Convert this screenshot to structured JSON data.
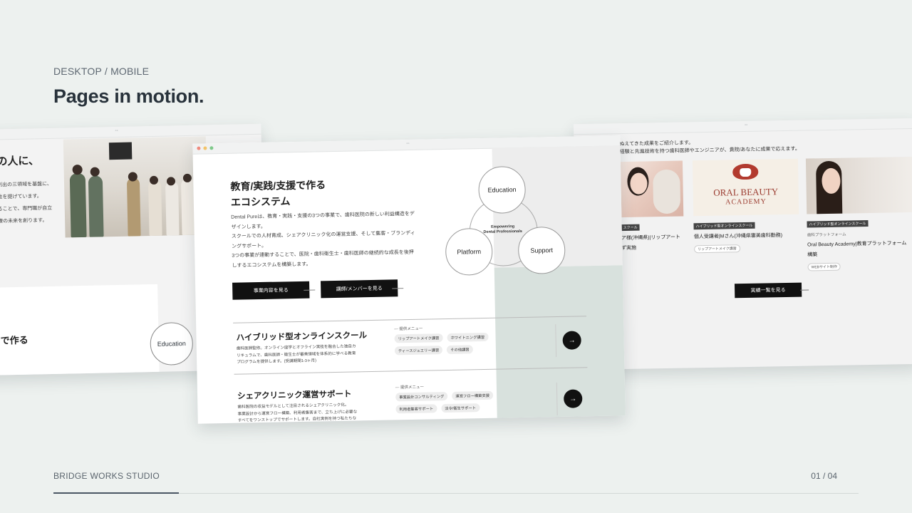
{
  "header": {
    "eyebrow": "DESKTOP / MOBILE",
    "title": "Pages in motion."
  },
  "footer": {
    "brand": "BRIDGE WORKS STUDIO",
    "page": "01 / 04",
    "progress": 0.156
  },
  "left_window": {
    "title": "の人に、",
    "lines": [
      "創出の三領域を基盤に、",
      "性を提げています。",
      "ることで、専門職が自立",
      "療の未来を創ります。"
    ],
    "card_title": "で作る",
    "circle_label": "Education"
  },
  "center_window": {
    "title_1": "教育/実践/支援で作る",
    "title_2": "エコシステム",
    "lead": [
      "Dental Pureは、教育・実践・支援の3つの事業で、歯科医院の新しい利益構造をデ",
      "ザインします。",
      "スクールでの人材育成、シェアクリニック化の運営支援、そして集客・ブランディ",
      "ングサポート。",
      "3つの事業が連動することで、医院・歯科衛生士・歯科医師の継続的な成長を後押",
      "しするエコシステムを構築します。"
    ],
    "buttons": {
      "services": "事業内容を見る",
      "members": "講師/メンバーを見る"
    },
    "venn": {
      "top": "Education",
      "left": "Platform",
      "right": "Support",
      "center_1": "Empowering",
      "center_2": "Dental Professionals"
    },
    "services": [
      {
        "title": "ハイブリッド型オンラインスクール",
        "desc": [
          "歯科医師監修。オンライン座学とオフライン実技を融合した独自カ",
          "リキュラムで、歯科医師・衛生士が審美領域を体系的に学べる教育",
          "プログラムを提供します。(受講期間1-3ヶ月)"
        ],
        "menu_label": "— 提供メニュー",
        "chips": [
          "リップアートメイク講習",
          "ホワイトニング講習",
          "ティースジュエリー講習",
          "その他講習"
        ]
      },
      {
        "title": "シェアクリニック運営サポート",
        "desc": [
          "歯科医院の収益モデルとして注目されるシェアクリニック化。",
          "事業設計から運営フロー構築、利用者集客まで、立ち上げに必要な",
          "すべてをワンストップでサポートします。自社実例を持つ私たちな"
        ],
        "menu_label": "— 提供メニュー",
        "chips": [
          "事業設計コンサルティング",
          "運営フロー構築支援",
          "利用者集客サポート",
          "法令/衛生サポート"
        ]
      }
    ],
    "arrow_icon": "→"
  },
  "right_window": {
    "intro_1": "ぬえてきた成果をご紹介します。",
    "intro_2": "経験と先進技術を持つ歯科医師やエンジニアが、貴院/あなたに成果で応えます。",
    "cards": [
      {
        "tag": "スクール",
        "name_1": "ア様(沖縄県)|リップアート",
        "name_2": "ず実施",
        "chip": ""
      },
      {
        "logo_1": "ORAL BEAUTY",
        "logo_2": "ACADEMY",
        "tag": "ハイブリッド型オンラインスクール",
        "name_1": "個人受講者|Mさん(沖縄県審美歯科勤務)",
        "name_2": "",
        "chip": "リップアートメイク講習"
      },
      {
        "tag": "ハイブリッド型オンラインスクール",
        "sub": "歯科プラットフォーム",
        "name_1": "Oral Beauty Academy|教育プラットフォーム",
        "name_2": "構築",
        "chip": "WEBサイト制作"
      }
    ],
    "button": "実績一覧を見る"
  }
}
